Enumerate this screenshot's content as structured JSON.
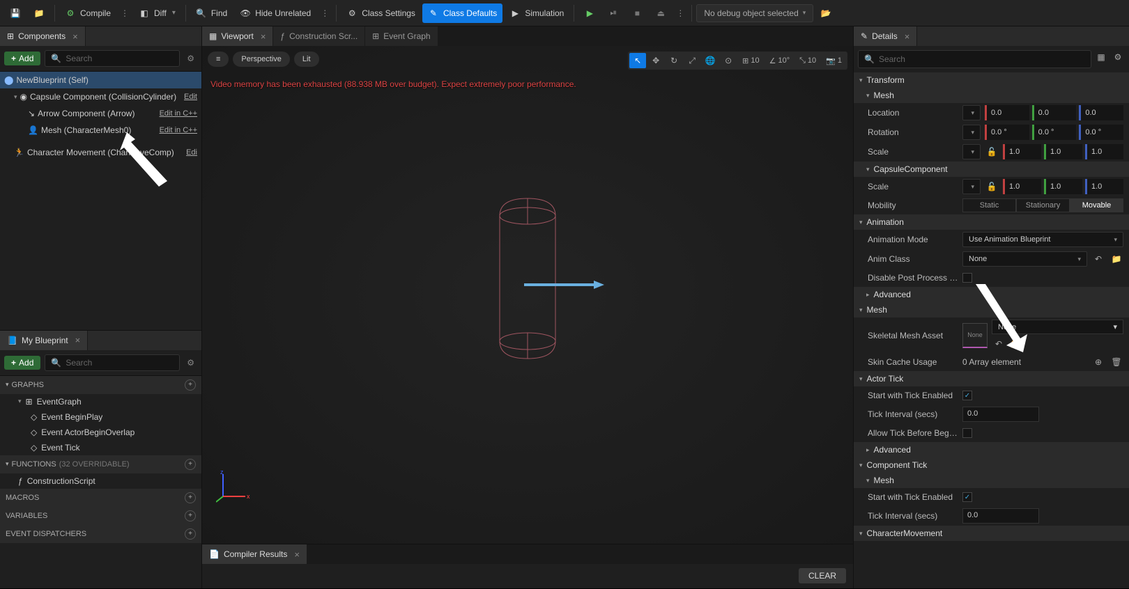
{
  "toolbar": {
    "compile": "Compile",
    "diff": "Diff",
    "find": "Find",
    "hide_unrelated": "Hide Unrelated",
    "class_settings": "Class Settings",
    "class_defaults": "Class Defaults",
    "simulation": "Simulation",
    "debug_selector": "No debug object selected"
  },
  "components": {
    "panel_title": "Components",
    "add": "Add",
    "search_placeholder": "Search",
    "items": {
      "root": "NewBlueprint (Self)",
      "capsule": "Capsule Component (CollisionCylinder)",
      "capsule_edit": "Edit",
      "arrow": "Arrow Component (Arrow)",
      "arrow_edit": "Edit in C++",
      "mesh": "Mesh (CharacterMesh0)",
      "mesh_edit": "Edit in C++",
      "movement": "Character Movement (CharMoveComp)",
      "movement_edit": "Edi"
    }
  },
  "my_blueprint": {
    "panel_title": "My Blueprint",
    "add": "Add",
    "search_placeholder": "Search",
    "graphs": "Graphs",
    "event_graph": "EventGraph",
    "event_begin": "Event BeginPlay",
    "event_overlap": "Event ActorBeginOverlap",
    "event_tick": "Event Tick",
    "functions": "Functions",
    "functions_count": "(32 OVERRIDABLE)",
    "construction": "ConstructionScript",
    "macros": "Macros",
    "variables": "Variables",
    "dispatchers": "Event Dispatchers"
  },
  "center_tabs": {
    "viewport": "Viewport",
    "construction": "Construction Scr...",
    "event_graph": "Event Graph"
  },
  "viewport": {
    "perspective": "Perspective",
    "lit": "Lit",
    "snap_grid": "10",
    "snap_angle": "10°",
    "snap_scale": "10",
    "camera_speed": "1",
    "warning": "Video memory has been exhausted (88.938 MB over budget). Expect extremely poor performance."
  },
  "compiler": {
    "title": "Compiler Results",
    "clear": "CLEAR"
  },
  "details": {
    "panel_title": "Details",
    "search_placeholder": "Search",
    "sections": {
      "transform": "Transform",
      "mesh": "Mesh",
      "capsule_comp": "CapsuleComponent",
      "animation": "Animation",
      "mesh2": "Mesh",
      "actor_tick": "Actor Tick",
      "component_tick": "Component Tick",
      "char_move": "CharacterMovement"
    },
    "rows": {
      "location": "Location",
      "rotation": "Rotation",
      "scale": "Scale",
      "mobility": "Mobility",
      "anim_mode": "Animation Mode",
      "anim_class": "Anim Class",
      "disable_pp": "Disable Post Process Blue..",
      "advanced": "Advanced",
      "skel_mesh": "Skeletal Mesh Asset",
      "skin_cache": "Skin Cache Usage",
      "skin_cache_val": "0 Array element",
      "start_tick": "Start with Tick Enabled",
      "tick_interval": "Tick Interval (secs)",
      "allow_tick": "Allow Tick Before Begin Pl.."
    },
    "values": {
      "loc": {
        "x": "0.0",
        "y": "0.0",
        "z": "0.0"
      },
      "rot": {
        "x": "0.0 °",
        "y": "0.0 °",
        "z": "0.0 °"
      },
      "scale": {
        "x": "1.0",
        "y": "1.0",
        "z": "1.0"
      },
      "capsule_scale": {
        "x": "1.0",
        "y": "1.0",
        "z": "1.0"
      },
      "mobility": {
        "static": "Static",
        "stationary": "Stationary",
        "movable": "Movable"
      },
      "anim_mode_val": "Use Animation Blueprint",
      "anim_class_val": "None",
      "skel_mesh_val": "None",
      "thumb_text": "None",
      "tick_interval_val": "0.0",
      "tick_interval_val2": "0.0"
    }
  }
}
